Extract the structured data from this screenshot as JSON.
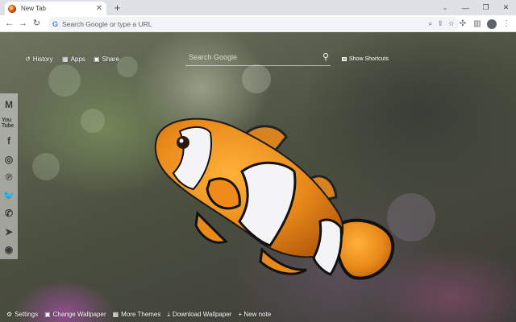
{
  "browser": {
    "tab_title": "New Tab",
    "tab_close": "✕",
    "new_tab": "+",
    "omnibox_placeholder": "Search Google or type a URL",
    "window_minimize": "—",
    "window_restore": "❐",
    "window_close": "✕"
  },
  "extension": {
    "history_label": "History",
    "apps_label": "Apps",
    "share_label": "Share",
    "search_placeholder": "Search Google",
    "show_shortcuts_label": "Show Shortcuts",
    "social_links": [
      {
        "name": "gmail",
        "glyph": "M"
      },
      {
        "name": "youtube",
        "glyph": "You Tube"
      },
      {
        "name": "facebook",
        "glyph": "f"
      },
      {
        "name": "instagram",
        "glyph": "◎"
      },
      {
        "name": "pinterest",
        "glyph": "℗"
      },
      {
        "name": "twitter",
        "glyph": "🐦"
      },
      {
        "name": "whatsapp",
        "glyph": "✆"
      },
      {
        "name": "telegram",
        "glyph": "➤"
      },
      {
        "name": "reddit",
        "glyph": "◉"
      }
    ],
    "bottom": {
      "settings_label": "Settings",
      "change_wallpaper_label": "Change Wallpaper",
      "more_themes_label": "More Themes",
      "download_wallpaper_label": "Download Wallpaper",
      "new_note_label": "+ New note"
    }
  },
  "colors": {
    "tabstrip": "#dee1e6",
    "toolbar": "#ffffff",
    "omnibox": "#f1f3f4",
    "fish_orange": "#e8891a",
    "fish_white": "#f4f4f6"
  }
}
